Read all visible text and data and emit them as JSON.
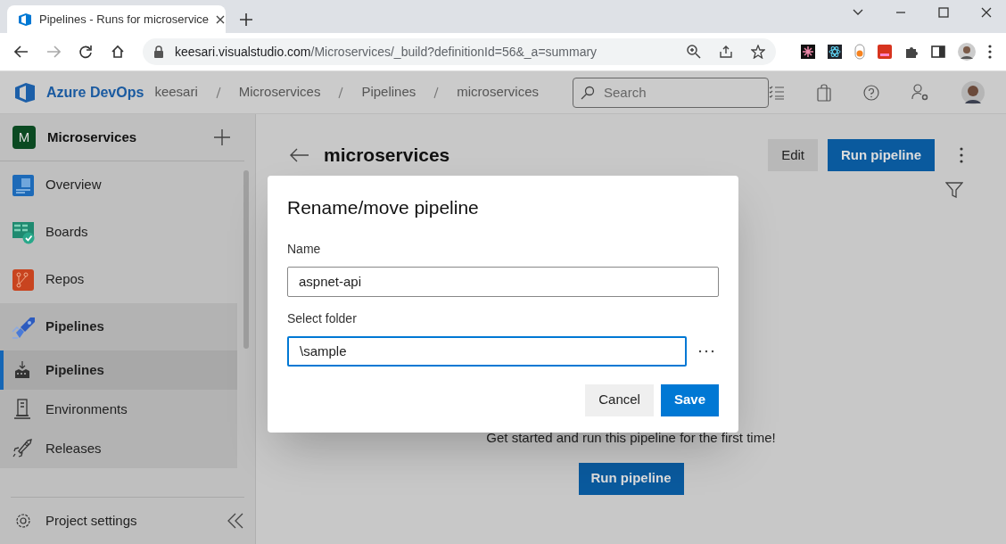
{
  "browser": {
    "tab_title": "Pipelines - Runs for microservice",
    "address_host": "keesari.visualstudio.com",
    "address_path": "/Microservices/_build?definitionId=56&_a=summary"
  },
  "header": {
    "brand": "Azure DevOps",
    "breadcrumbs": [
      "keesari",
      "Microservices",
      "Pipelines",
      "microservices"
    ],
    "search": {
      "placeholder": "Search"
    }
  },
  "sidebar": {
    "project": {
      "initial": "M",
      "name": "Microservices"
    },
    "items": [
      {
        "label": "Overview",
        "kind": "overview",
        "expanded": false
      },
      {
        "label": "Boards",
        "kind": "boards",
        "expanded": false
      },
      {
        "label": "Repos",
        "kind": "repos",
        "expanded": false
      },
      {
        "label": "Pipelines",
        "kind": "pipelines",
        "expanded": true,
        "children": [
          {
            "label": "Pipelines",
            "kind": "pipes",
            "selected": true
          },
          {
            "label": "Environments",
            "kind": "environments",
            "selected": false
          },
          {
            "label": "Releases",
            "kind": "releases",
            "selected": false
          }
        ]
      }
    ],
    "footer": "Project settings"
  },
  "page": {
    "title": "microservices",
    "buttons": [
      {
        "label": "Edit",
        "kind": "secondary"
      },
      {
        "label": "Run pipeline",
        "kind": "primary"
      }
    ],
    "empty_message": "Get started and run this pipeline for the first time!",
    "empty_button": "Run pipeline"
  },
  "dialog": {
    "title": "Rename/move pipeline",
    "fields": [
      {
        "label": "Name",
        "value": "aspnet-api",
        "focused": false,
        "browse": false
      },
      {
        "label": "Select folder",
        "value": "\\sample",
        "focused": true,
        "browse": true
      }
    ],
    "buttons": [
      {
        "label": "Cancel",
        "kind": "secondary"
      },
      {
        "label": "Save",
        "kind": "primary"
      }
    ]
  }
}
